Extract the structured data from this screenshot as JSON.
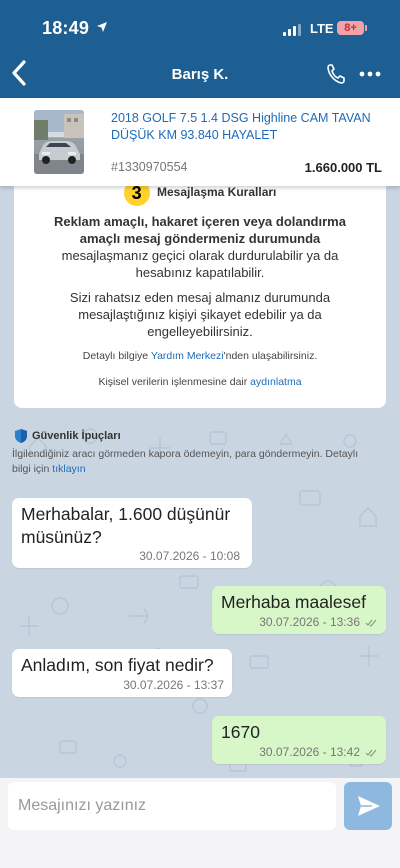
{
  "status_bar": {
    "time": "18:49",
    "network": "LTE",
    "battery": "8+"
  },
  "header": {
    "title": "Barış K."
  },
  "listing": {
    "title": "2018 GOLF 7.5 1.4 DSG Highline CAM TAVAN DÜŞÜK KM 93.840 HAYALET",
    "id": "#1330970554",
    "price": "1.660.000 TL"
  },
  "rules": {
    "badge": "3",
    "heading": "Mesajlaşma Kuralları",
    "bold_text": "Reklam amaçlı, hakaret içeren veya dolandırma amaçlı mesaj göndermeniz durumunda",
    "normal_text": "mesajlaşmanız geçici olarak durdurulabilir ya da hesabınız kapatılabilir.",
    "paragraph2": "Sizi rahatsız eden mesaj almanız durumunda mesajlaştığınız kişiyi şikayet edebilir ya da engelleyebilirsiniz.",
    "help_prefix": "Detaylı bilgiye ",
    "help_link": "Yardım Merkezi",
    "help_suffix": "'nden ulaşabilirsiniz.",
    "kvkk_prefix": "Kişisel verilerin işlenmesine dair ",
    "kvkk_link": "aydınlatma"
  },
  "tips": {
    "title": "Güvenlik İpuçları",
    "text": "İlgilendiğiniz aracı görmeden kapora ödemeyin, para göndermeyin. Detaylı bilgi için ",
    "link": "tıklayın"
  },
  "messages": [
    {
      "direction": "in",
      "text": "Merhabalar, 1.600 düşünür müsünüz?",
      "time": "30.07.2026 - 10:08"
    },
    {
      "direction": "out",
      "text": "Merhaba maalesef",
      "time": "30.07.2026 - 13:36"
    },
    {
      "direction": "in",
      "text": "Anladım, son fiyat nedir?",
      "time": "30.07.2026 - 13:37"
    },
    {
      "direction": "out",
      "text": "1670",
      "time": "30.07.2026 - 13:42"
    }
  ],
  "composer": {
    "placeholder": "Mesajınızı yazınız"
  },
  "colors": {
    "header": "#1e5f93",
    "link": "#1e6bb8",
    "outgoing": "#d8f7c9",
    "incoming": "#ffffff",
    "badge": "#ffd22e"
  }
}
